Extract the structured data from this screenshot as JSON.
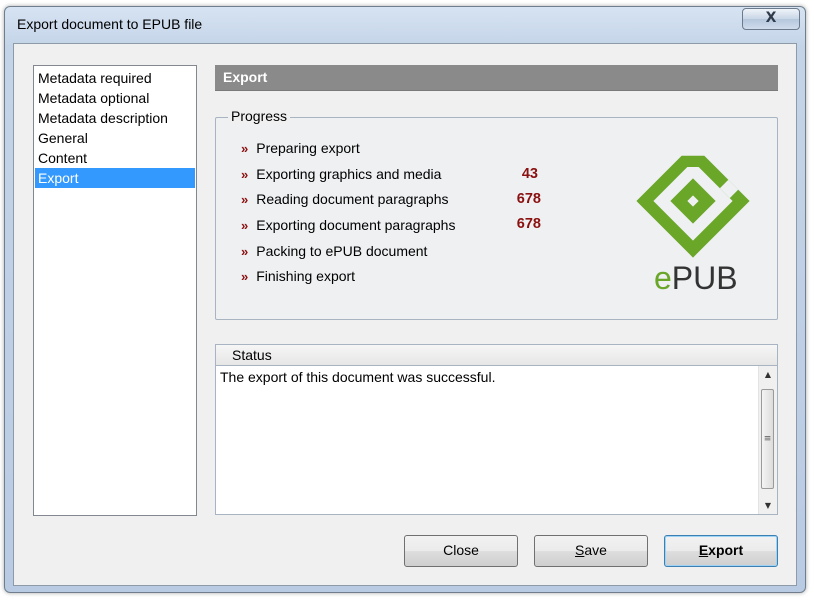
{
  "window": {
    "title": "Export document to EPUB file",
    "close_glyph": "X"
  },
  "nav": {
    "items": [
      {
        "label": "Metadata required"
      },
      {
        "label": "Metadata optional"
      },
      {
        "label": "Metadata description"
      },
      {
        "label": "General"
      },
      {
        "label": "Content"
      },
      {
        "label": "Export",
        "selected": true
      }
    ]
  },
  "section": {
    "title": "Export"
  },
  "progress": {
    "legend": "Progress",
    "arrow": "»",
    "steps": [
      {
        "label": "Preparing export",
        "count": ""
      },
      {
        "label": "Exporting graphics and media",
        "count": "43"
      },
      {
        "label": "Reading document paragraphs",
        "count": "678"
      },
      {
        "label": "Exporting document paragraphs",
        "count": "678"
      },
      {
        "label": "Packing to ePUB document",
        "count": ""
      },
      {
        "label": "Finishing export",
        "count": ""
      }
    ]
  },
  "logo": {
    "text_e": "e",
    "text_rest": "PUB",
    "color_green": "#6aa628"
  },
  "status": {
    "header": "Status",
    "message": "The export of this document was successful."
  },
  "buttons": {
    "close": "Close",
    "save_first": "S",
    "save_rest": "ave",
    "export_first": "E",
    "export_rest": "xport"
  },
  "colors": {
    "accent_selected": "#3399ff",
    "count_color": "#8b1010",
    "header_gray": "#8a8a8a"
  }
}
